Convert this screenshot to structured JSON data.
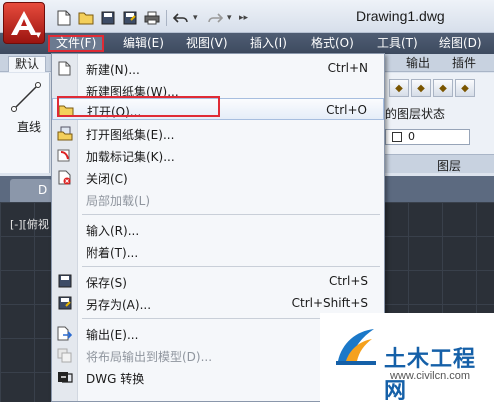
{
  "window": {
    "doc_title": "Drawing1.dwg"
  },
  "menubar": {
    "items": [
      {
        "label": "文件(F)",
        "active": true
      },
      {
        "label": "编辑(E)"
      },
      {
        "label": "视图(V)"
      },
      {
        "label": "插入(I)"
      },
      {
        "label": "格式(O)"
      },
      {
        "label": "工具(T)"
      },
      {
        "label": "绘图(D)"
      }
    ]
  },
  "ribbon": {
    "tabs": [
      {
        "label": "默认",
        "active": true
      },
      {
        "label": "输出"
      },
      {
        "label": "插件"
      }
    ],
    "draw_panel": {
      "line_label": "直线"
    },
    "layer_panel": {
      "state_label": "的图层状态",
      "layer_value": "0",
      "footer_label": "图层"
    }
  },
  "doc_tab": {
    "label": "D"
  },
  "canvas": {
    "viewport_label": "[-][俯视"
  },
  "file_menu": {
    "items": [
      {
        "label": "新建(N)...",
        "shortcut": "Ctrl+N",
        "icon": "new-file-icon"
      },
      {
        "label": "新建图纸集(W)...",
        "shortcut": "",
        "icon": ""
      },
      {
        "label": "打开(O)...",
        "shortcut": "Ctrl+O",
        "icon": "open-folder-icon",
        "highlighted": true
      },
      {
        "label": "打开图纸集(E)...",
        "shortcut": "",
        "icon": "open-sheetset-icon"
      },
      {
        "label": "加载标记集(K)...",
        "shortcut": "",
        "icon": "markup-icon"
      },
      {
        "label": "关闭(C)",
        "shortcut": "",
        "icon": "close-doc-icon"
      },
      {
        "label": "局部加载(L)",
        "shortcut": "",
        "icon": "",
        "disabled": true
      },
      {
        "label": "输入(R)...",
        "shortcut": "",
        "icon": ""
      },
      {
        "label": "附着(T)...",
        "shortcut": "",
        "icon": ""
      },
      {
        "label": "保存(S)",
        "shortcut": "Ctrl+S",
        "icon": "save-icon"
      },
      {
        "label": "另存为(A)...",
        "shortcut": "Ctrl+Shift+S",
        "icon": "save-as-icon"
      },
      {
        "label": "输出(E)...",
        "shortcut": "",
        "icon": "export-icon"
      },
      {
        "label": "将布局输出到模型(D)...",
        "shortcut": "",
        "icon": "layout-export-icon",
        "disabled": true
      },
      {
        "label": "DWG 转换",
        "shortcut": "",
        "icon": "dwg-convert-icon"
      }
    ]
  },
  "watermark": {
    "name": "土木工程网",
    "url": "www.civilcn.com"
  },
  "colors": {
    "accent_red": "#e02b35",
    "menubar_bg": "#46546a",
    "canvas_bg": "#2b3038"
  }
}
